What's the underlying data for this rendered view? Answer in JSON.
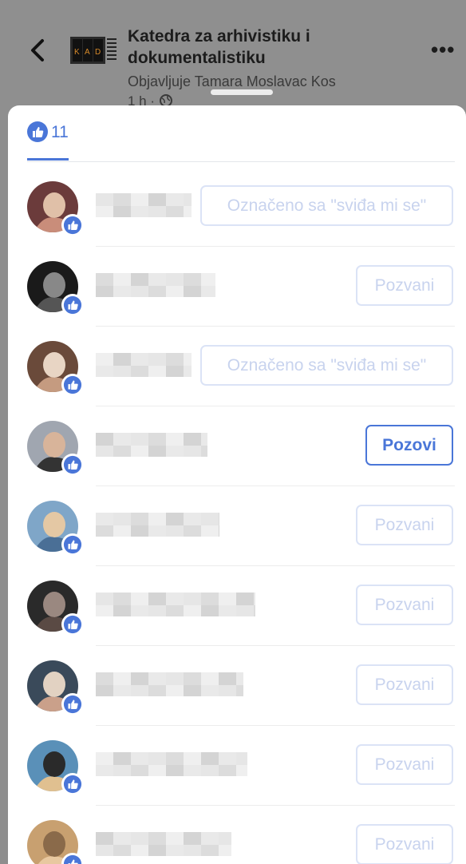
{
  "header": {
    "page_name": "Katedra za arhivistiku i dokumentalistiku",
    "posted_by": "Objavljuje Tamara Moslavac Kos",
    "time": "1 h · ",
    "logo_letters": "KAD"
  },
  "tab": {
    "count": "11"
  },
  "colors": {
    "accent": "#4a76d8",
    "faded": "#c8d3ee"
  },
  "rows": [
    {
      "button": "Označeno sa \"sviđa mi se\"",
      "state": "liked"
    },
    {
      "button": "Pozvani",
      "state": "invited"
    },
    {
      "button": "Označeno sa \"sviđa mi se\"",
      "state": "liked"
    },
    {
      "button": "Pozovi",
      "state": "invite"
    },
    {
      "button": "Pozvani",
      "state": "invited"
    },
    {
      "button": "Pozvani",
      "state": "invited"
    },
    {
      "button": "Pozvani",
      "state": "invited"
    },
    {
      "button": "Pozvani",
      "state": "invited"
    },
    {
      "button": "Pozvani",
      "state": "invited"
    }
  ]
}
